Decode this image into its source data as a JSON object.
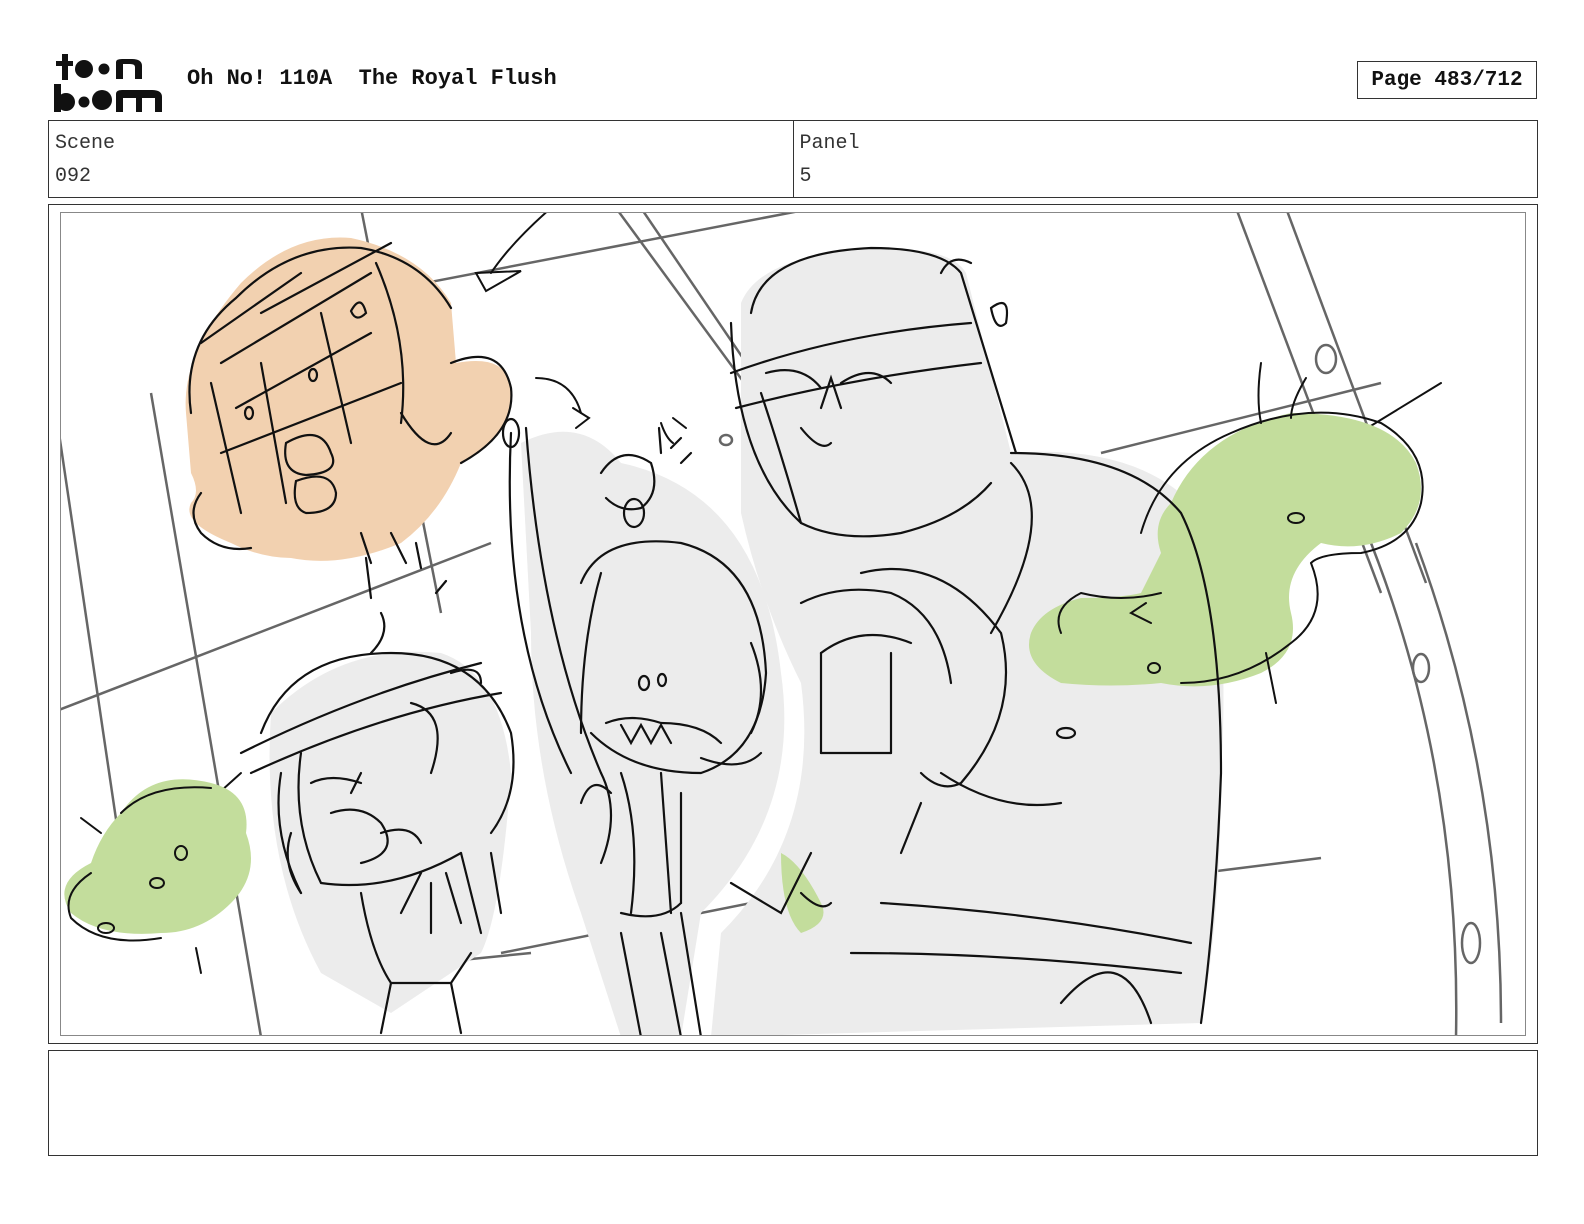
{
  "header": {
    "logo_text": "toonboom",
    "title": "Oh No! 110A  The Royal Flush",
    "page_label": "Page 483/712"
  },
  "info": {
    "scene_label": "Scene",
    "scene_value": "092",
    "panel_label": "Panel",
    "panel_value": "5"
  },
  "panel": {
    "colors": {
      "skin": "#f2d1b0",
      "slime": "#c3dd9c",
      "fill": "#ececec",
      "line": "#111111",
      "bg_line": "#666666"
    }
  },
  "notes": {
    "text": ""
  }
}
